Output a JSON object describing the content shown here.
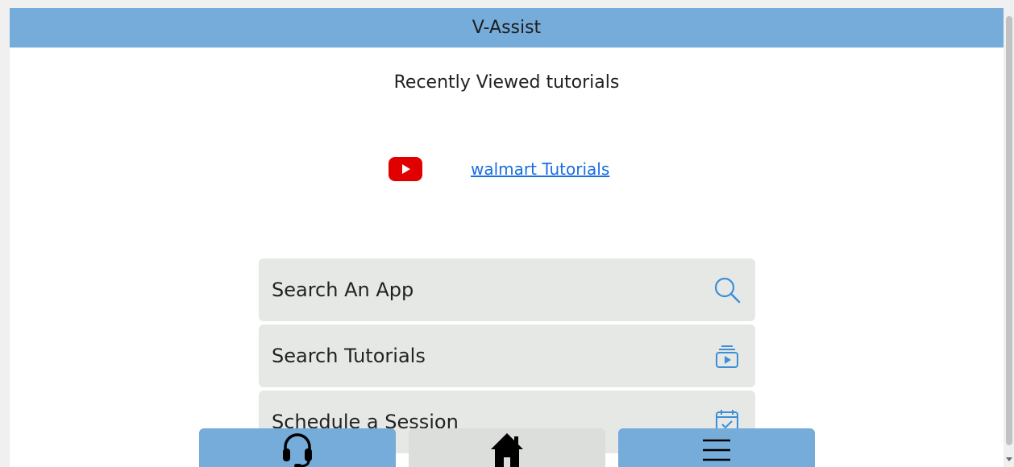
{
  "header": {
    "title": "V-Assist"
  },
  "recent": {
    "title": "Recently Viewed tutorials",
    "items": [
      {
        "icon": "youtube-icon",
        "label": "walmart Tutorials"
      }
    ]
  },
  "menu": {
    "items": [
      {
        "label": "Search An App",
        "icon": "search-icon"
      },
      {
        "label": "Search Tutorials",
        "icon": "video-library-icon"
      },
      {
        "label": "Schedule a Session",
        "icon": "calendar-check-icon"
      }
    ]
  },
  "bottom_nav": {
    "items": [
      {
        "icon": "headset-icon"
      },
      {
        "icon": "home-icon"
      },
      {
        "icon": "hamburger-menu-icon"
      }
    ]
  },
  "colors": {
    "header_bg": "#75acd9",
    "link": "#1a6fe0",
    "menu_bg": "#e6e8e6",
    "icon_accent": "#3a8fd8",
    "youtube_red": "#e00000"
  }
}
